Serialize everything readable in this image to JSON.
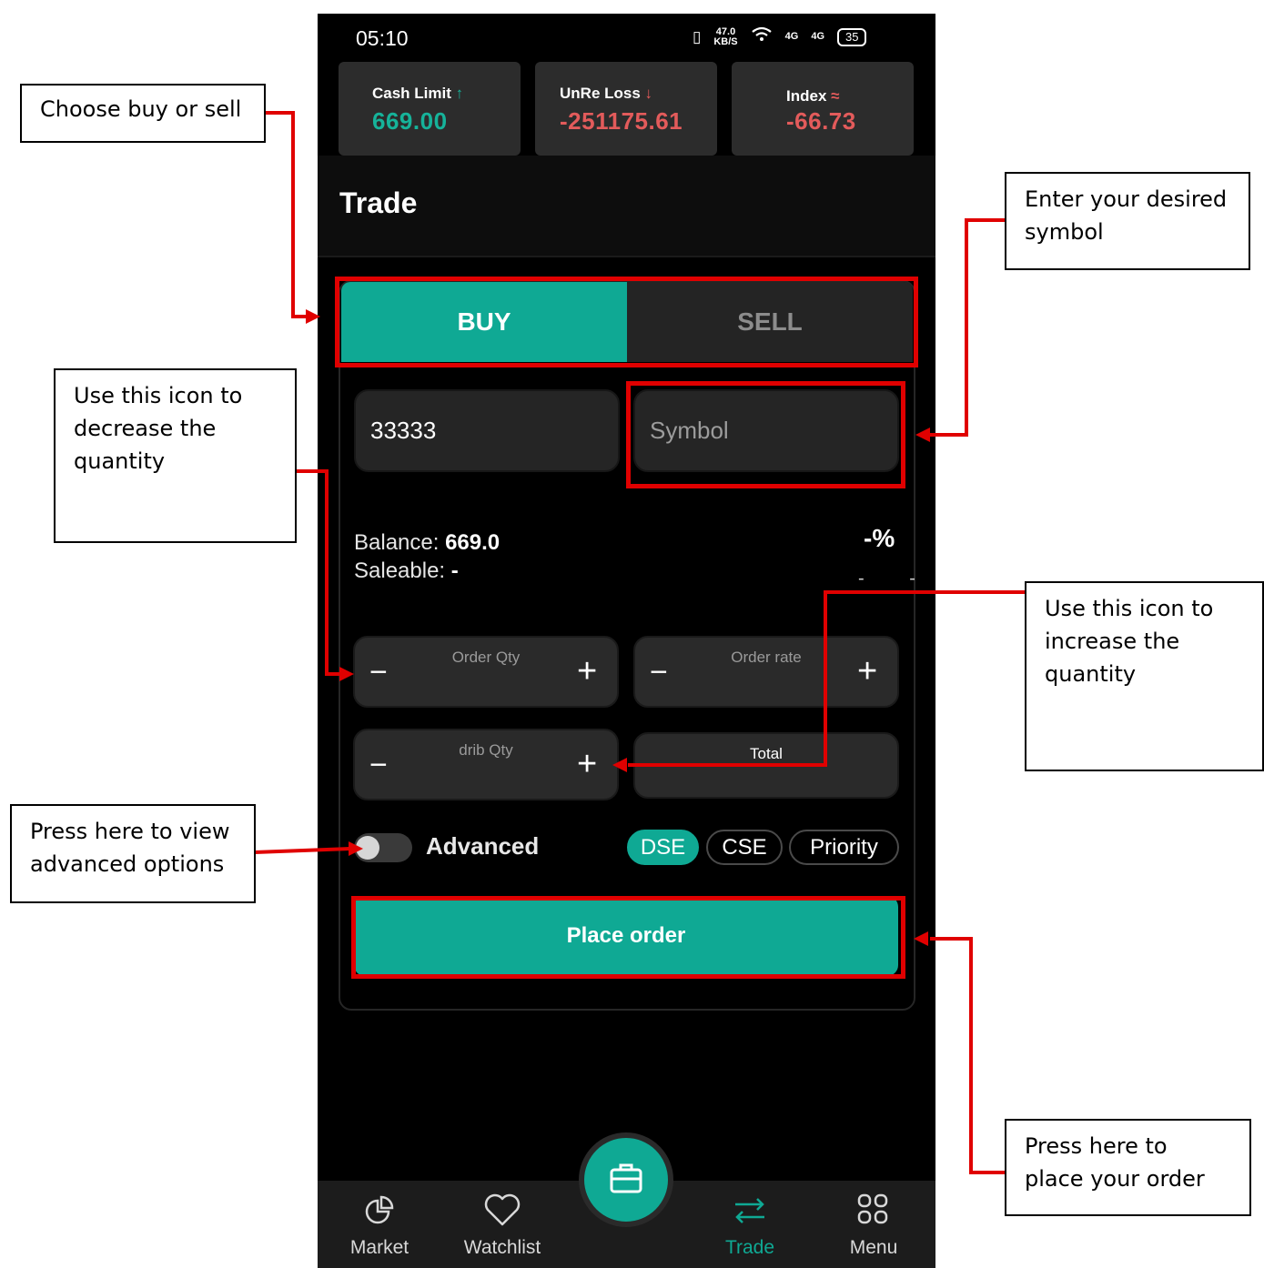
{
  "status_bar": {
    "time": "05:10",
    "net_speed_value": "47.0",
    "net_speed_unit": "KB/S",
    "signal_1": "4G",
    "signal_2": "4G",
    "battery": "35"
  },
  "header_cards": [
    {
      "label": "Cash Limit",
      "value": "669.00",
      "trend": "up",
      "color": "#16b39a"
    },
    {
      "label": "UnRe Loss",
      "value": "-251175.61",
      "trend": "down",
      "color": "#e35b5b"
    },
    {
      "label": "Index",
      "value": "-66.73",
      "trend": "offline",
      "color": "#e35b5b"
    }
  ],
  "page_title": "Trade",
  "tabs": {
    "buy": "BUY",
    "sell": "SELL"
  },
  "form": {
    "account_value": "33333",
    "symbol_placeholder": "Symbol",
    "balance_label": "Balance:",
    "balance_value": "669.0",
    "saleable_label": "Saleable:",
    "saleable_value": "-",
    "percent": "-%",
    "change": "- -",
    "order_qty_label": "Order Qty",
    "order_rate_label": "Order rate",
    "drib_qty_label": "drib Qty",
    "total_label": "Total",
    "minus": "−",
    "plus": "+",
    "advanced_label": "Advanced",
    "exchanges": [
      "DSE",
      "CSE",
      "Priority"
    ],
    "active_exchange": "DSE",
    "place_order_label": "Place order"
  },
  "nav": {
    "items": [
      {
        "label": "Market",
        "icon": "pie-chart-icon"
      },
      {
        "label": "Watchlist",
        "icon": "heart-icon"
      },
      {
        "label": "Trade",
        "icon": "swap-arrows-icon"
      },
      {
        "label": "Menu",
        "icon": "grid-icon"
      }
    ],
    "active": "Trade",
    "fab_icon": "briefcase-icon"
  },
  "annotations": {
    "buy_sell": "Choose buy or sell",
    "symbol": "Enter your desired symbol",
    "decrease": "Use this icon to decrease the quantity",
    "increase": "Use this icon to increase the quantity",
    "advanced": "Press here to view advanced options",
    "place_order": "Press here to place your order",
    "color": "#e00000"
  },
  "colors": {
    "accent": "#0fa994",
    "background": "#000000",
    "negative": "#e35b5b"
  }
}
